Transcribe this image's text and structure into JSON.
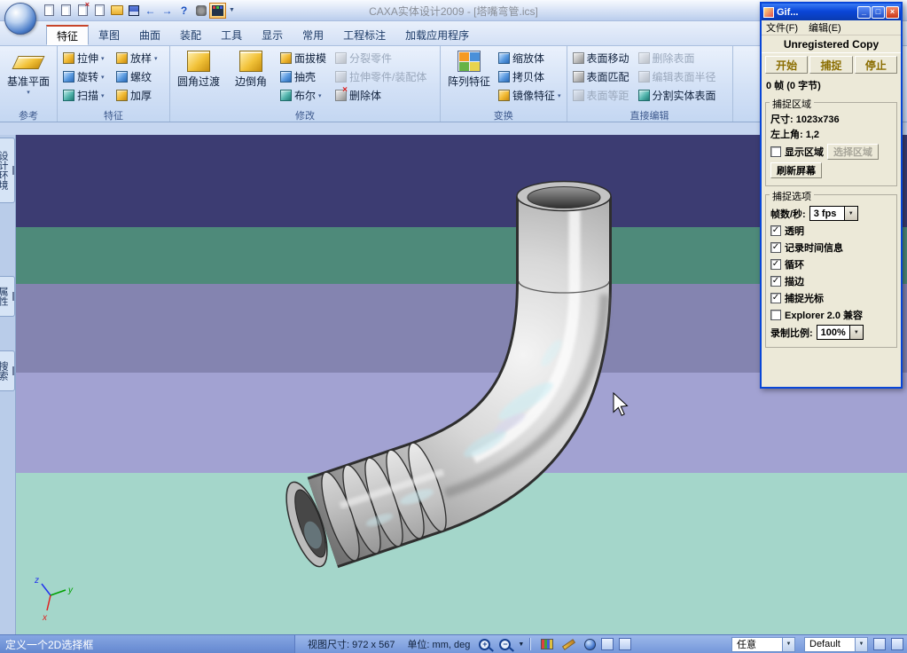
{
  "colors": {
    "band_dark": "#3c3c72",
    "band_teal": "#4e8a7a",
    "band_mauve": "#8484b0",
    "band_lilac": "#a2a2d2",
    "band_mint": "#a4d6ca",
    "titlebar_blue": "#0a46d8",
    "ribbon_bg": "#d3e1f6"
  },
  "window": {
    "title": "CAXA实体设计2009 - [塔嘴弯管.ics]"
  },
  "quick_toolbar": {
    "undo": "←",
    "redo": "→",
    "help": "?",
    "overflow": "▼"
  },
  "tabs": [
    {
      "label": "特征"
    },
    {
      "label": "草图"
    },
    {
      "label": "曲面"
    },
    {
      "label": "装配"
    },
    {
      "label": "工具"
    },
    {
      "label": "显示"
    },
    {
      "label": "常用"
    },
    {
      "label": "工程标注"
    },
    {
      "label": "加载应用程序"
    }
  ],
  "ribbon": {
    "refs": {
      "caption": "参考",
      "big": "基准平面",
      "arrow": "▾"
    },
    "feat": {
      "caption": "特征",
      "items": [
        {
          "label": "拉伸",
          "arrow": "▾"
        },
        {
          "label": "放样",
          "arrow": "▾"
        },
        {
          "label": "旋转",
          "arrow": "▾"
        },
        {
          "label": "螺纹",
          "arrow": ""
        },
        {
          "label": "扫描",
          "arrow": "▾"
        },
        {
          "label": "加厚",
          "arrow": ""
        }
      ]
    },
    "mod": {
      "caption": "修改",
      "big1": "圆角过渡",
      "big2": "边倒角",
      "items": [
        {
          "label": "面拔模",
          "arrow": ""
        },
        {
          "label": "分裂零件",
          "arrow": ""
        },
        {
          "label": "抽壳",
          "arrow": ""
        },
        {
          "label": "拉伸零件/装配体",
          "arrow": ""
        },
        {
          "label": "布尔",
          "arrow": "▾"
        },
        {
          "label": "删除体",
          "arrow": ""
        }
      ]
    },
    "trans": {
      "caption": "变换",
      "big": "阵列特征",
      "items": [
        {
          "label": "缩放体",
          "arrow": ""
        },
        {
          "label": "拷贝体",
          "arrow": ""
        },
        {
          "label": "镜像特征",
          "arrow": "▾"
        }
      ]
    },
    "edit": {
      "caption": "直接编辑",
      "items": [
        {
          "label": "表面移动",
          "arrow": ""
        },
        {
          "label": "删除表面",
          "arrow": ""
        },
        {
          "label": "表面匹配",
          "arrow": ""
        },
        {
          "label": "编辑表面半径",
          "arrow": ""
        },
        {
          "label": "表面等距",
          "arrow": ""
        },
        {
          "label": "分割实体表面",
          "arrow": ""
        }
      ]
    }
  },
  "sidebar": {
    "tabs": [
      {
        "label": "设计环境"
      },
      {
        "label": "属性"
      },
      {
        "label": "搜索"
      }
    ]
  },
  "statusbar": {
    "hint": "定义一个2D选择框",
    "view_size": "视图尺寸: 972 x 567",
    "units": "单位: mm, deg",
    "zoom_in": "+",
    "zoom_out": "−",
    "caret": "▼",
    "combo_any": "任意",
    "combo_default": "Default"
  },
  "gif_tool": {
    "title": "Gif...",
    "win_min": "_",
    "win_restore": "□",
    "win_close": "×",
    "menu_file": "文件(F)",
    "menu_edit": "编辑(E)",
    "registration": "Unregistered Copy",
    "btn_start": "开始",
    "btn_capture": "捕捉",
    "btn_stop": "停止",
    "frames": "0 帧 (0 字节)",
    "area": {
      "caption": "捕捉区域",
      "size": "尺寸: 1023x736",
      "origin": "左上角: 1,2",
      "show_area_label": "显示区域",
      "show_area_mark": "",
      "select_btn": "选择区域",
      "refresh_btn": "刷新屏幕"
    },
    "options": {
      "caption": "捕捉选项",
      "fps_label": "帧数/秒:",
      "fps_value": "3 fps",
      "checks": [
        {
          "label": "透明",
          "mark": "✓"
        },
        {
          "label": "记录时间信息",
          "mark": "✓"
        },
        {
          "label": "循环",
          "mark": "✓"
        },
        {
          "label": "描边",
          "mark": "✓"
        },
        {
          "label": "捕捉光标",
          "mark": "✓"
        },
        {
          "label": "Explorer 2.0 兼容",
          "mark": ""
        }
      ],
      "scale_label": "录制比例:",
      "scale_value": "100%"
    }
  }
}
